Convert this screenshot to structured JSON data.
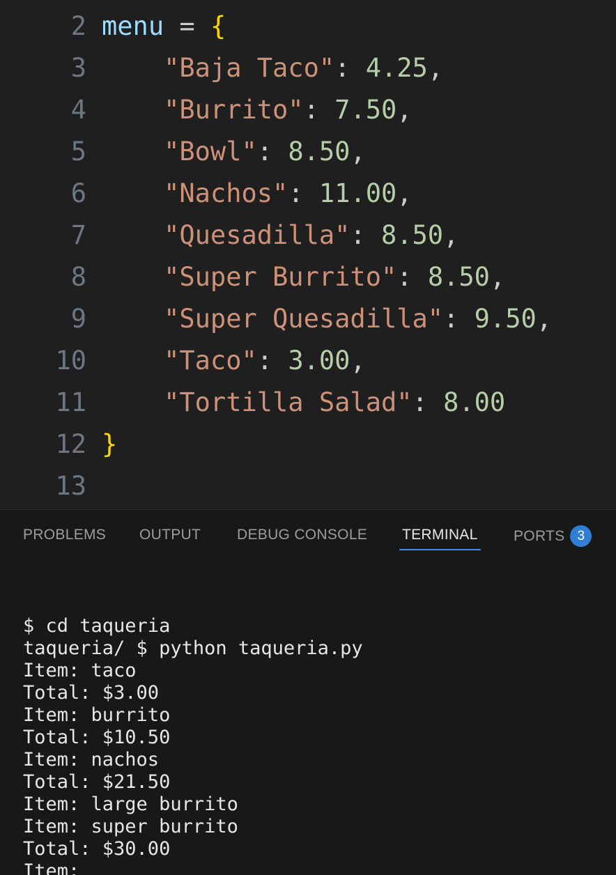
{
  "editor": {
    "lines": [
      {
        "n": "2",
        "tokens": [
          {
            "t": "var",
            "v": "menu"
          },
          {
            "t": "op",
            "v": " = "
          },
          {
            "t": "brace",
            "v": "{"
          }
        ]
      },
      {
        "n": "3",
        "tokens": [
          {
            "t": "str",
            "v": "    \"Baja Taco\""
          },
          {
            "t": "punc",
            "v": ": "
          },
          {
            "t": "num",
            "v": "4.25"
          },
          {
            "t": "punc",
            "v": ","
          }
        ]
      },
      {
        "n": "4",
        "tokens": [
          {
            "t": "str",
            "v": "    \"Burrito\""
          },
          {
            "t": "punc",
            "v": ": "
          },
          {
            "t": "num",
            "v": "7.50"
          },
          {
            "t": "punc",
            "v": ","
          }
        ]
      },
      {
        "n": "5",
        "tokens": [
          {
            "t": "str",
            "v": "    \"Bowl\""
          },
          {
            "t": "punc",
            "v": ": "
          },
          {
            "t": "num",
            "v": "8.50"
          },
          {
            "t": "punc",
            "v": ","
          }
        ]
      },
      {
        "n": "6",
        "tokens": [
          {
            "t": "str",
            "v": "    \"Nachos\""
          },
          {
            "t": "punc",
            "v": ": "
          },
          {
            "t": "num",
            "v": "11.00"
          },
          {
            "t": "punc",
            "v": ","
          }
        ]
      },
      {
        "n": "7",
        "tokens": [
          {
            "t": "str",
            "v": "    \"Quesadilla\""
          },
          {
            "t": "punc",
            "v": ": "
          },
          {
            "t": "num",
            "v": "8.50"
          },
          {
            "t": "punc",
            "v": ","
          }
        ]
      },
      {
        "n": "8",
        "tokens": [
          {
            "t": "str",
            "v": "    \"Super Burrito\""
          },
          {
            "t": "punc",
            "v": ": "
          },
          {
            "t": "num",
            "v": "8.50"
          },
          {
            "t": "punc",
            "v": ","
          }
        ]
      },
      {
        "n": "9",
        "tokens": [
          {
            "t": "str",
            "v": "    \"Super Quesadilla\""
          },
          {
            "t": "punc",
            "v": ": "
          },
          {
            "t": "num",
            "v": "9.50"
          },
          {
            "t": "punc",
            "v": ","
          }
        ]
      },
      {
        "n": "10",
        "tokens": [
          {
            "t": "str",
            "v": "    \"Taco\""
          },
          {
            "t": "punc",
            "v": ": "
          },
          {
            "t": "num",
            "v": "3.00"
          },
          {
            "t": "punc",
            "v": ","
          }
        ]
      },
      {
        "n": "11",
        "tokens": [
          {
            "t": "str",
            "v": "    \"Tortilla Salad\""
          },
          {
            "t": "punc",
            "v": ": "
          },
          {
            "t": "num",
            "v": "8.00"
          }
        ]
      },
      {
        "n": "12",
        "tokens": [
          {
            "t": "brace",
            "v": "}"
          }
        ]
      },
      {
        "n": "13",
        "tokens": []
      }
    ]
  },
  "panel": {
    "tabs": {
      "problems": "PROBLEMS",
      "output": "OUTPUT",
      "debug_console": "DEBUG CONSOLE",
      "terminal": "TERMINAL",
      "ports": "PORTS",
      "ports_badge": "3"
    },
    "active_tab": "terminal"
  },
  "terminal": {
    "lines": [
      "$ cd taqueria",
      "taqueria/ $ python taqueria.py",
      "Item: taco",
      "Total: $3.00",
      "Item: burrito",
      "Total: $10.50",
      "Item: nachos",
      "Total: $21.50",
      "Item: large burrito",
      "Item: super burrito",
      "Total: $30.00",
      "Item:"
    ],
    "prompt": "taqueria/ $"
  },
  "colors": {
    "editor_bg": "#1f1f1f",
    "panel_bg": "#181818",
    "variable": "#9cdcfe",
    "string": "#ce9178",
    "number": "#b5cea8",
    "brace": "#ffd700",
    "line_number": "#6e7681",
    "accent": "#3b8eea",
    "badge": "#2f7fd6"
  }
}
